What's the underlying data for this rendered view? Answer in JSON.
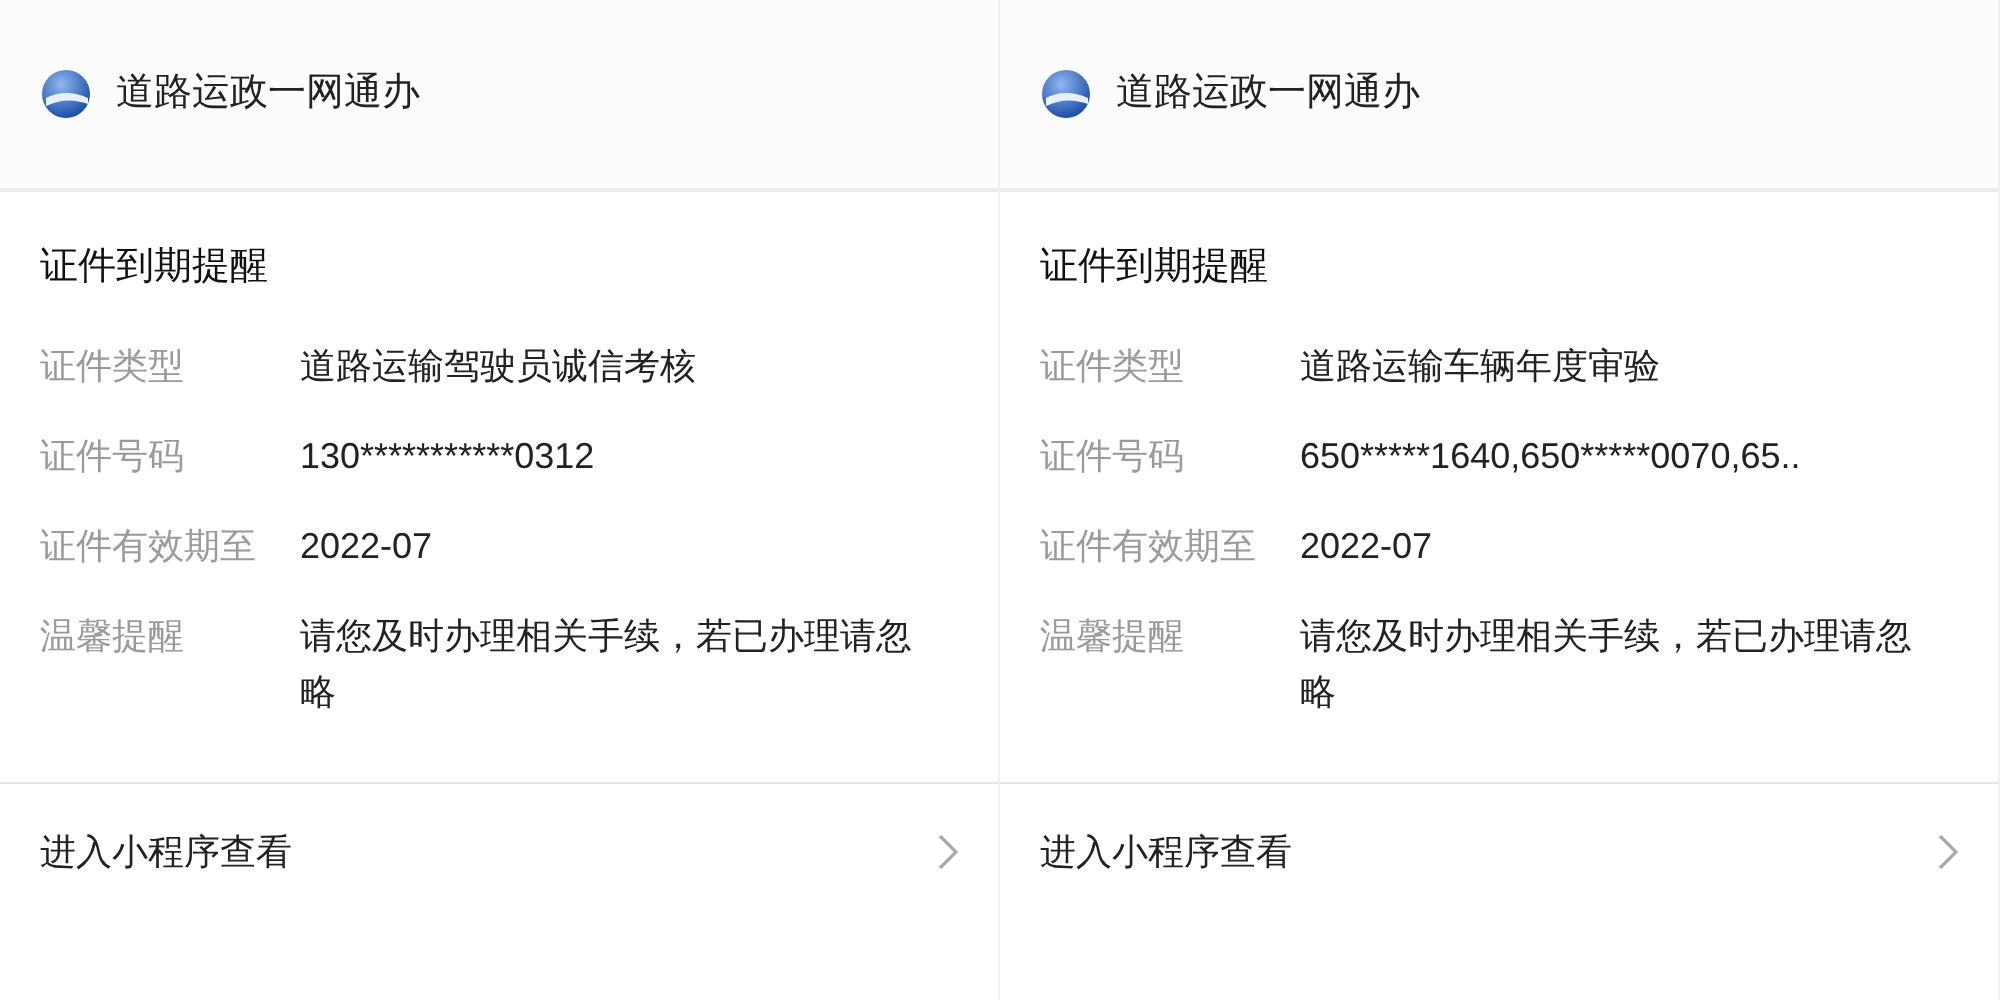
{
  "cards": [
    {
      "app_name": "道路运政一网通办",
      "title": "证件到期提醒",
      "fields": [
        {
          "label": "证件类型",
          "value": "道路运输驾驶员诚信考核"
        },
        {
          "label": "证件号码",
          "value": "130***********0312"
        },
        {
          "label": "证件有效期至",
          "value": "2022-07"
        },
        {
          "label": "温馨提醒",
          "value": "请您及时办理相关手续，若已办理请忽略"
        }
      ],
      "link": "进入小程序查看"
    },
    {
      "app_name": "道路运政一网通办",
      "title": "证件到期提醒",
      "fields": [
        {
          "label": "证件类型",
          "value": "道路运输车辆年度审验"
        },
        {
          "label": "证件号码",
          "value": "650*****1640,650*****0070,65.."
        },
        {
          "label": "证件有效期至",
          "value": "2022-07"
        },
        {
          "label": "温馨提醒",
          "value": "请您及时办理相关手续，若已办理请忽略"
        }
      ],
      "link": "进入小程序查看"
    }
  ]
}
